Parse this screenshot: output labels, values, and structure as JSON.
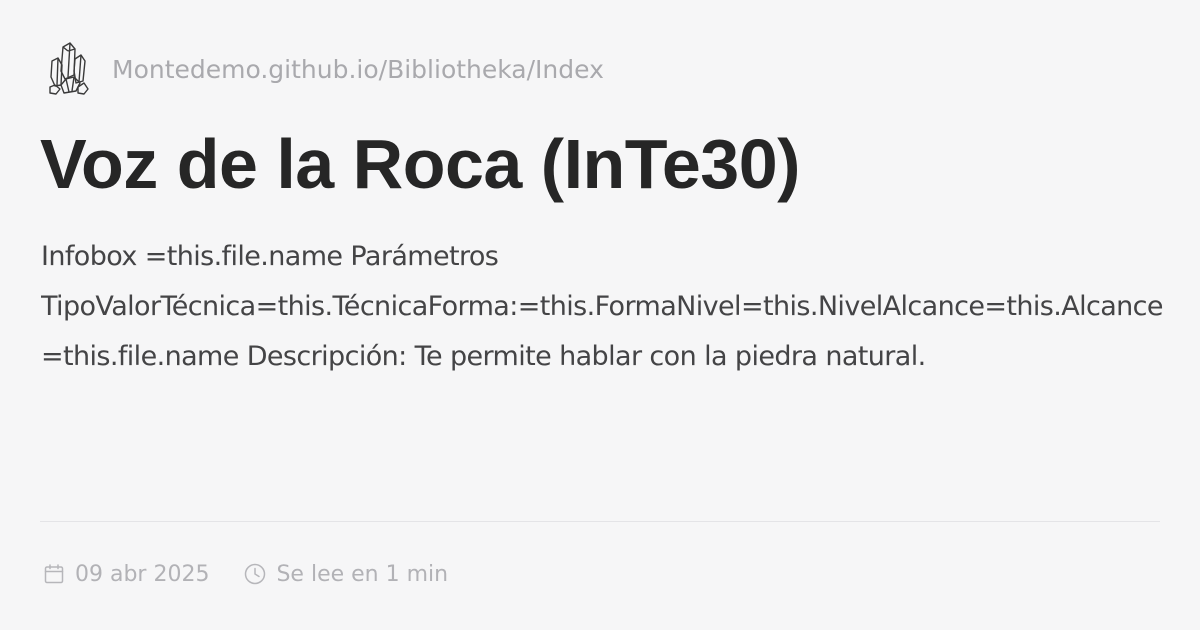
{
  "site": {
    "logo_icon": "crystal-cluster-icon",
    "url": "Montedemo.github.io/Bibliotheka/Index"
  },
  "page": {
    "title": "Voz de la Roca (InTe30)",
    "description_lines": [
      "Infobox =this.file.name Parámetros",
      "TipoValorTécnica=this.TécnicaForma:=this.FormaNivel=this.NivelAlcance=this.Alcance",
      "=this.file.name Descripción: Te permite hablar con la piedra natural."
    ]
  },
  "meta": {
    "date_icon": "calendar-icon",
    "date": "09 abr 2025",
    "reading_icon": "clock-icon",
    "reading_time": "Se lee en 1 min"
  },
  "colors": {
    "background": "#f6f6f7",
    "title": "#262626",
    "muted": "#a9a9ad"
  }
}
